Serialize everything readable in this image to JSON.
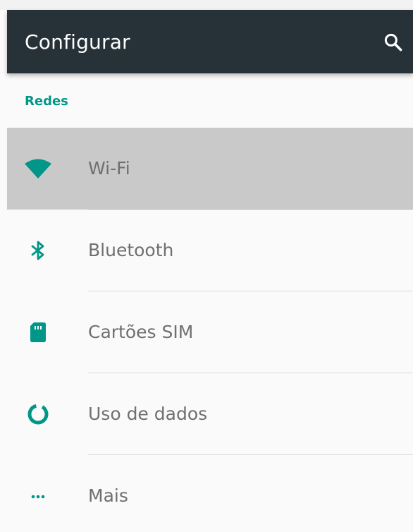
{
  "app_bar": {
    "title": "Configurar",
    "search_icon": "search-icon",
    "background": "#263238"
  },
  "section": {
    "header": "Redes",
    "accent": "#009688"
  },
  "items": [
    {
      "label": "Wi-Fi",
      "icon": "wifi-icon",
      "selected": true
    },
    {
      "label": "Bluetooth",
      "icon": "bluetooth-icon",
      "selected": false
    },
    {
      "label": "Cartões SIM",
      "icon": "sim-card-icon",
      "selected": false
    },
    {
      "label": "Uso de dados",
      "icon": "data-usage-icon",
      "selected": false
    },
    {
      "label": "Mais",
      "icon": "more-horiz-icon",
      "selected": false
    }
  ]
}
